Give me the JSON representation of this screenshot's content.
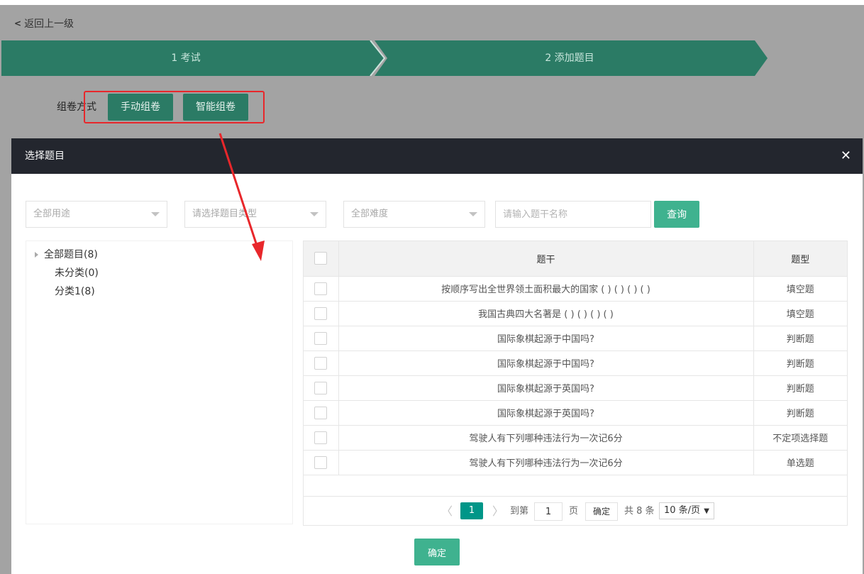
{
  "page": {
    "back_label": "返回上一级",
    "steps": [
      "1 考试",
      "2 添加题目"
    ],
    "compose_label": "组卷方式",
    "compose_buttons": [
      "手动组卷",
      "智能组卷"
    ]
  },
  "modal": {
    "title": "选择题目",
    "close_icon": "close-icon",
    "filters": {
      "usage": "全部用途",
      "type": "请选择题目类型",
      "difficulty": "全部难度",
      "search_placeholder": "请输入题干名称",
      "query_label": "查询"
    },
    "tree": {
      "root": "全部题目(8)",
      "children": [
        "未分类(0)",
        "分类1(8)"
      ]
    },
    "table": {
      "headers": [
        "题干",
        "题型"
      ],
      "rows": [
        {
          "stem": "按顺序写出全世界领土面积最大的国家 ( ) ( ) ( ) ( )",
          "type": "填空题"
        },
        {
          "stem": "我国古典四大名著是 ( ) ( ) ( ) ( )",
          "type": "填空题"
        },
        {
          "stem": "国际象棋起源于中国吗?",
          "type": "判断题"
        },
        {
          "stem": "国际象棋起源于中国吗?",
          "type": "判断题"
        },
        {
          "stem": "国际象棋起源于英国吗?",
          "type": "判断题"
        },
        {
          "stem": "国际象棋起源于英国吗?",
          "type": "判断题"
        },
        {
          "stem": "驾驶人有下列哪种违法行为一次记6分",
          "type": "不定项选择题"
        },
        {
          "stem": "驾驶人有下列哪种违法行为一次记6分",
          "type": "单选题"
        }
      ]
    },
    "pager": {
      "prev": "〈",
      "current": "1",
      "next": "〉",
      "goto_label": "到第",
      "goto_value": "1",
      "page_unit": "页",
      "confirm": "确定",
      "total": "共 8 条",
      "page_size": "10 条/页"
    },
    "confirm_label": "确定"
  },
  "colors": {
    "step_bar": "#2b7b65",
    "primary_button": "#3fb28f",
    "pager_active": "#009688",
    "annotation": "#e8272b",
    "modal_header": "#23262e"
  }
}
